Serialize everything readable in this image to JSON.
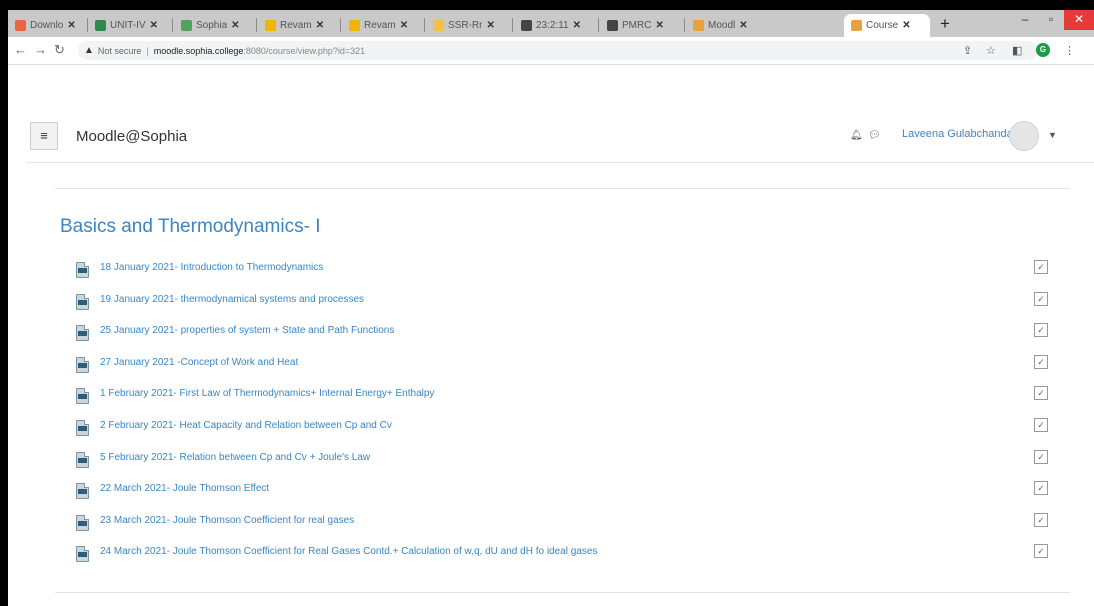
{
  "browser": {
    "tabs": [
      {
        "title": "Downlo",
        "color": "#e8663d"
      },
      {
        "title": "UNIT-IV",
        "color": "#2d8a4e"
      },
      {
        "title": "Sophia",
        "color": "#4fa35b"
      },
      {
        "title": "Revam",
        "color": "#f2b400"
      },
      {
        "title": "Revam",
        "color": "#f2b400"
      },
      {
        "title": "SSR-Rr",
        "color": "#f2c04a"
      },
      {
        "title": "23:2:11",
        "color": "#444444"
      },
      {
        "title": "PMRC",
        "color": "#444444"
      },
      {
        "title": "Moodl",
        "color": "#e8a23d"
      },
      {
        "title": "Course",
        "color": "#e8a23d"
      }
    ],
    "new_tab": "+",
    "window_controls": {
      "minimize": "–",
      "maximize": "▫",
      "close": "✕"
    },
    "address": {
      "security_label": "Not secure",
      "host": "moodle.sophia.college",
      "path": ":8080/course/view.php?id=321"
    },
    "profile_initial": "G"
  },
  "navbar": {
    "menu_glyph": "≡",
    "site_name": "Moodle@Sophia",
    "user_name": "Laveena Gulabchandani"
  },
  "section": {
    "title": "Basics and Thermodynamics- I",
    "activities": [
      {
        "name": "18 January 2021- Introduction to Thermodynamics"
      },
      {
        "name": "19 January 2021- thermodynamical systems and processes"
      },
      {
        "name": "25 January 2021- properties of system + State and Path Functions"
      },
      {
        "name": "27 January 2021 -Concept of Work and Heat"
      },
      {
        "name": "1 February 2021- First Law of Thermodynamics+ Internal Energy+ Enthalpy"
      },
      {
        "name": "2 February 2021- Heat Capacity and Relation between Cp and Cv"
      },
      {
        "name": "5 February 2021- Relation between Cp and Cv + Joule's Law"
      },
      {
        "name": "22 March 2021- Joule Thomson Effect"
      },
      {
        "name": "23 March 2021- Joule Thomson Coefficient for real gases"
      },
      {
        "name": "24 March 2021- Joule Thomson Coefficient for Real Gases Contd.+ Calculation of w,q, dU and dH fo ideal gases"
      }
    ]
  },
  "colors": {
    "link": "#3a86c4",
    "accent_close": "#e5393a"
  }
}
